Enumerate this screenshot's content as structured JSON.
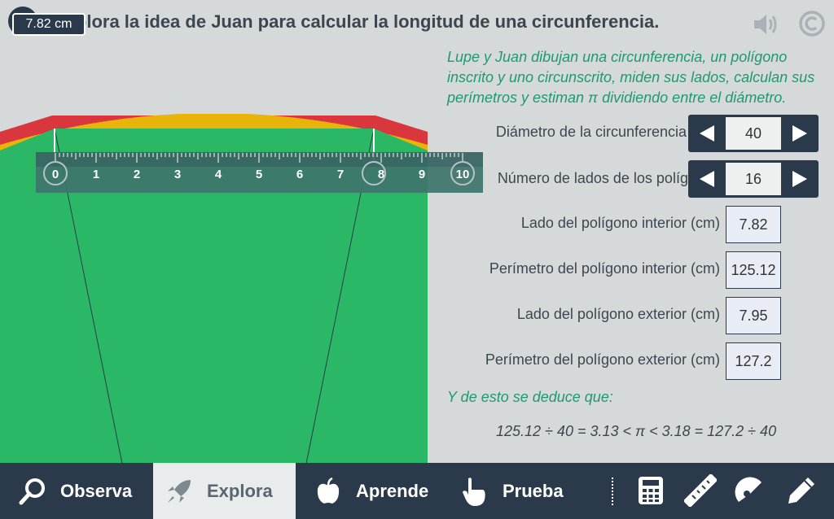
{
  "header": {
    "title": "Explora la idea de Juan para calcular la longitud de una circunferencia.",
    "tooltip": "7.82 cm"
  },
  "description": "Lupe y Juan dibujan una circunferencia, un polígono inscrito y uno circunscrito, miden sus lados, calculan sus perímetros y estiman π dividiendo entre el diámetro.",
  "controls": {
    "diameter": {
      "label": "Diámetro de la circunferencia (cm)",
      "value": "40"
    },
    "sides": {
      "label": "Número de lados de los polígonos",
      "value": "16"
    }
  },
  "results": [
    {
      "label": "Lado del polígono interior (cm)",
      "value": "7.82"
    },
    {
      "label": "Perímetro del polígono interior (cm)",
      "value": "125.12"
    },
    {
      "label": "Lado del polígono exterior (cm)",
      "value": "7.95"
    },
    {
      "label": "Perímetro del polígono exterior (cm)",
      "value": "127.2"
    }
  ],
  "deduce": "Y de esto se deduce que:",
  "formula": "125.12 ÷ 40 = 3.13 < π < 3.18 = 127.2 ÷ 40",
  "ruler": {
    "ticks": [
      "0",
      "1",
      "2",
      "3",
      "4",
      "5",
      "6",
      "7",
      "8",
      "9",
      "10"
    ]
  },
  "nav": {
    "observa": "Observa",
    "explora": "Explora",
    "aprende": "Aprende",
    "prueba": "Prueba"
  },
  "icons": {
    "info": "info-icon",
    "sound": "speaker-icon",
    "copyright": "copyright-icon",
    "observa": "magnifier-icon",
    "explora": "rocket-icon",
    "aprende": "apple-icon",
    "prueba": "hand-pointer-icon",
    "calculator": "calculator-icon",
    "ruler": "ruler-icon",
    "protractor": "protractor-icon",
    "pencil": "pencil-icon"
  },
  "colors": {
    "green": "#2ab866",
    "red": "#d9363e",
    "yellow": "#e8b40a",
    "dark": "#2b3a4a",
    "accent_text": "#1e9a6e"
  }
}
